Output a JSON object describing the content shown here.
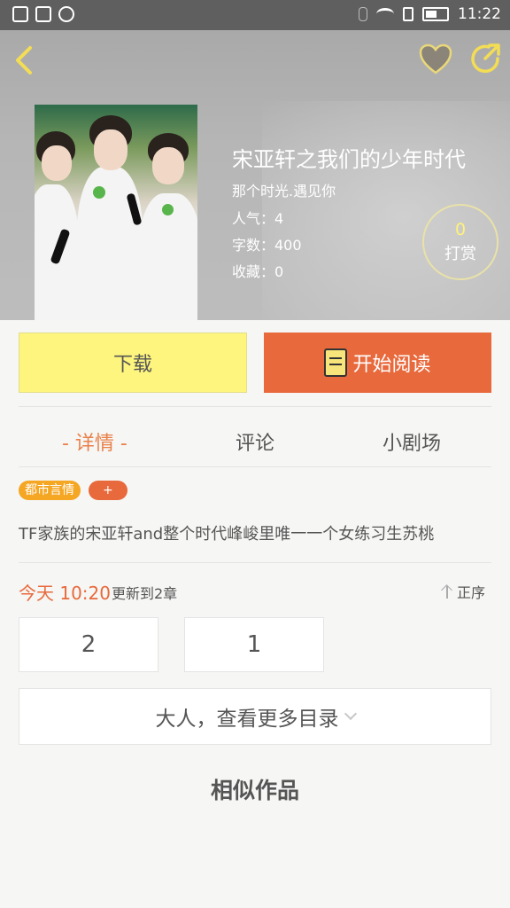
{
  "status_bar": {
    "time": "11:22",
    "icons": [
      "sim-icon",
      "image-icon",
      "shield-icon",
      "bluetooth-icon",
      "wifi-icon",
      "sim-card-icon",
      "battery-icon"
    ]
  },
  "header": {
    "title": "宋亚轩之我们的少年时代",
    "subtitle": "那个时光.遇见你",
    "popularity": "人气：4",
    "word_count": "字数：400",
    "favorites": "收藏：0",
    "tip": {
      "count": "0",
      "label": "打赏"
    }
  },
  "actions": {
    "download": "下载",
    "read": "开始阅读"
  },
  "tabs": [
    "- 详情 -",
    "评论",
    "小剧场"
  ],
  "tags": {
    "genre": "都市言情",
    "add": "+"
  },
  "description": "TF家族的宋亚轩and整个时代峰峻里唯一一个女练习生苏桃",
  "update": {
    "time": "今天 10:20",
    "text": "更新到2章",
    "sort": "正序"
  },
  "chapters": [
    "2",
    "1"
  ],
  "more_catalog": "大人，查看更多目录",
  "similar_title": "相似作品",
  "colors": {
    "accent": "#e8693c",
    "download_bg": "#fdf57d",
    "active_tab": "#e9804a",
    "tag_genre": "#f5a623",
    "tip_number": "#fff27a"
  }
}
